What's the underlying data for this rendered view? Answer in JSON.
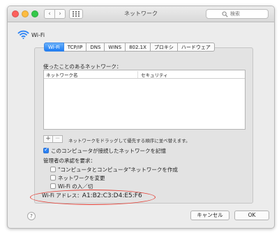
{
  "window": {
    "title": "ネットワーク",
    "search_placeholder": "検索"
  },
  "header": {
    "label": "Wi-Fi"
  },
  "tabs": [
    "Wi-Fi",
    "TCP/IP",
    "DNS",
    "WINS",
    "802.1X",
    "プロキシ",
    "ハードウェア"
  ],
  "active_tab": "Wi-Fi",
  "known_networks": {
    "label": "使ったことのあるネットワーク：",
    "columns": [
      "ネットワーク名",
      "セキュリティ"
    ],
    "rows": []
  },
  "list_controls": {
    "add": "+",
    "remove": "−",
    "hint": "ネットワークをドラッグして優先する順序に並べ替えます。"
  },
  "remember": {
    "label": "このコンピュータが接続したネットワークを記憶",
    "checked": true
  },
  "admin": {
    "label": "管理者の承認を要求：",
    "options": [
      {
        "label": "\"コンピュータとコンピュータ\"ネットワークを作成",
        "checked": false
      },
      {
        "label": "ネットワークを変更",
        "checked": false
      },
      {
        "label": "Wi-Fi の入／切",
        "checked": false
      }
    ]
  },
  "wifi_address": {
    "label": "Wi-Fi アドレス：",
    "value": "A1:B2:C3:D4:E5:F6"
  },
  "buttons": {
    "cancel": "キャンセル",
    "ok": "OK",
    "help": "?"
  },
  "colors": {
    "tab_active": "#1c7cf4",
    "annotation": "#e53f35"
  }
}
